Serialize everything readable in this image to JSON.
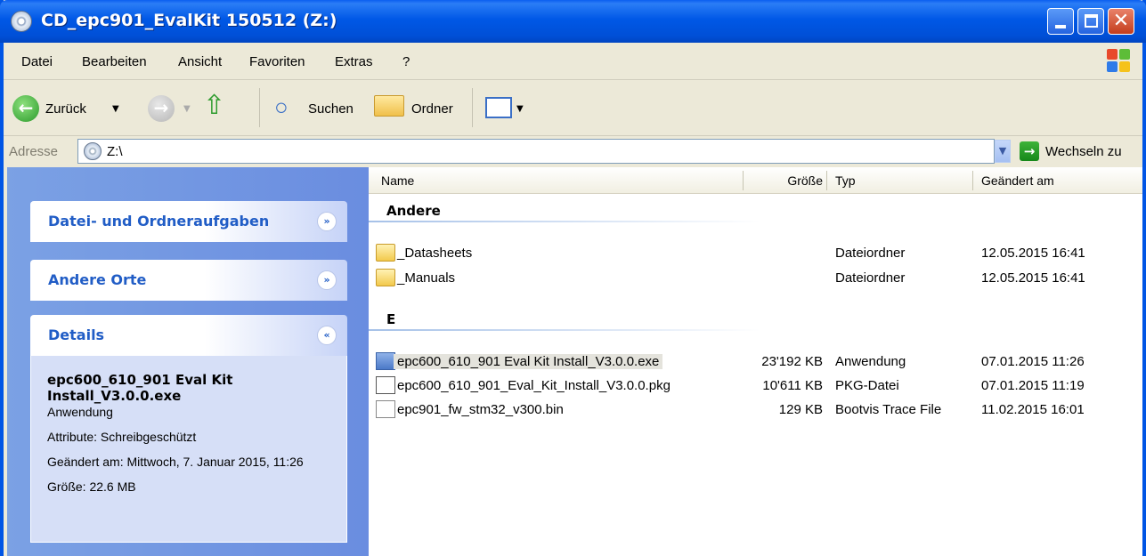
{
  "window": {
    "title": "CD_epc901_EvalKit 150512 (Z:)"
  },
  "menu": [
    "Datei",
    "Bearbeiten",
    "Ansicht",
    "Favoriten",
    "Extras",
    "?"
  ],
  "toolbar": {
    "back": "Zurück",
    "search": "Suchen",
    "folders": "Ordner"
  },
  "address": {
    "label": "Adresse",
    "value": "Z:\\",
    "go": "Wechseln zu"
  },
  "taskpane": {
    "panels": [
      "Datei- und Ordneraufgaben",
      "Andere Orte",
      "Details"
    ],
    "details": {
      "name": "epc600_610_901 Eval Kit Install_V3.0.0.exe",
      "type": "Anwendung",
      "attributes": "Attribute: Schreibgeschützt",
      "modified": "Geändert am: Mittwoch, 7. Januar 2015, 11:26",
      "size": "Größe: 22.6 MB"
    }
  },
  "columns": {
    "name": "Name",
    "size": "Größe",
    "type": "Typ",
    "modified": "Geändert am"
  },
  "groups": [
    {
      "title": "Andere",
      "items": [
        {
          "icon": "folder-icon",
          "name": "_Datasheets",
          "size": "",
          "type": "Dateiordner",
          "date": "12.05.2015 16:41"
        },
        {
          "icon": "folder-icon",
          "name": "_Manuals",
          "size": "",
          "type": "Dateiordner",
          "date": "12.05.2015 16:41"
        }
      ]
    },
    {
      "title": "E",
      "items": [
        {
          "icon": "exe-icon",
          "name": "epc600_610_901 Eval Kit Install_V3.0.0.exe",
          "size": "23'192 KB",
          "type": "Anwendung",
          "date": "07.01.2015 11:26"
        },
        {
          "icon": "pkg-icon",
          "name": "epc600_610_901_Eval_Kit_Install_V3.0.0.pkg",
          "size": "10'611 KB",
          "type": "PKG-Datei",
          "date": "07.01.2015 11:19"
        },
        {
          "icon": "bin-icon",
          "name": "epc901_fw_stm32_v300.bin",
          "size": "129 KB",
          "type": "Bootvis Trace File",
          "date": "11.02.2015 16:01"
        }
      ]
    }
  ]
}
